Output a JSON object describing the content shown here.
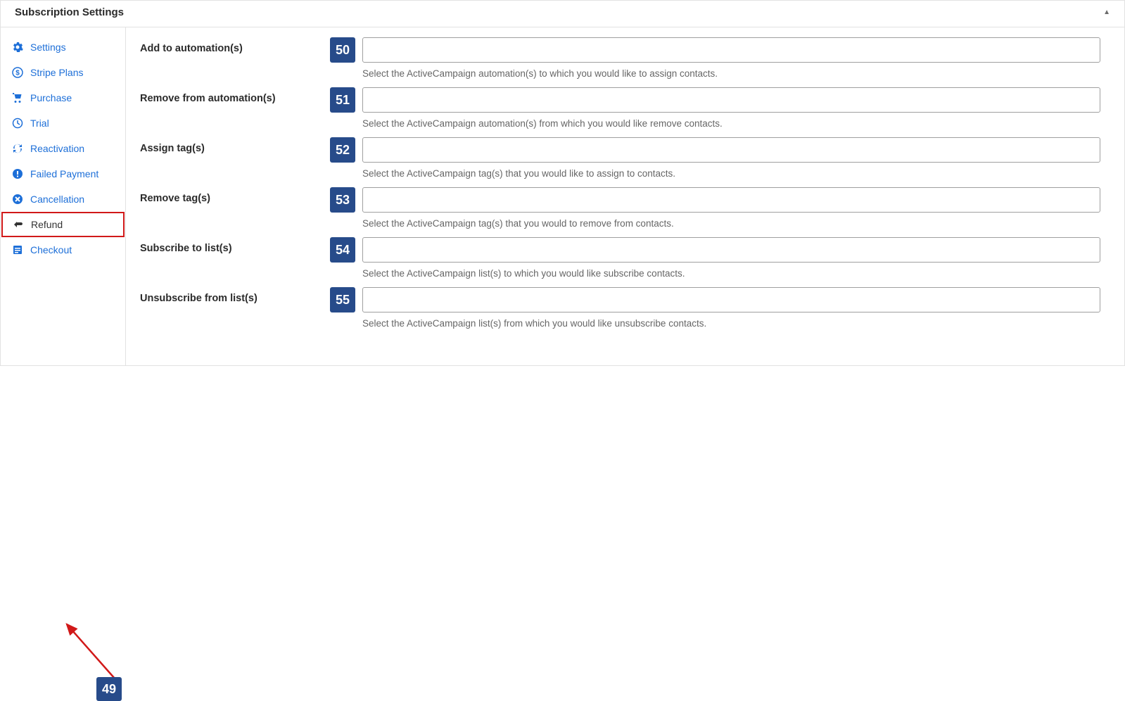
{
  "header": {
    "title": "Subscription Settings"
  },
  "sidebar": {
    "items": [
      {
        "label": "Settings"
      },
      {
        "label": "Stripe Plans"
      },
      {
        "label": "Purchase"
      },
      {
        "label": "Trial"
      },
      {
        "label": "Reactivation"
      },
      {
        "label": "Failed Payment"
      },
      {
        "label": "Cancellation"
      },
      {
        "label": "Refund"
      },
      {
        "label": "Checkout"
      }
    ]
  },
  "fields": [
    {
      "num": "50",
      "label": "Add to automation(s)",
      "help": "Select the ActiveCampaign automation(s) to which you would like to assign contacts."
    },
    {
      "num": "51",
      "label": "Remove from automation(s)",
      "help": "Select the ActiveCampaign automation(s) from which you would like remove contacts."
    },
    {
      "num": "52",
      "label": "Assign tag(s)",
      "help": "Select the ActiveCampaign tag(s) that you would like to assign to contacts."
    },
    {
      "num": "53",
      "label": "Remove tag(s)",
      "help": "Select the ActiveCampaign tag(s) that you would to remove from contacts."
    },
    {
      "num": "54",
      "label": "Subscribe to list(s)",
      "help": "Select the ActiveCampaign list(s) to which you would like subscribe contacts."
    },
    {
      "num": "55",
      "label": "Unsubscribe from list(s)",
      "help": "Select the ActiveCampaign list(s) from which you would like unsubscribe contacts."
    }
  ],
  "annotation": {
    "badge": "49"
  }
}
